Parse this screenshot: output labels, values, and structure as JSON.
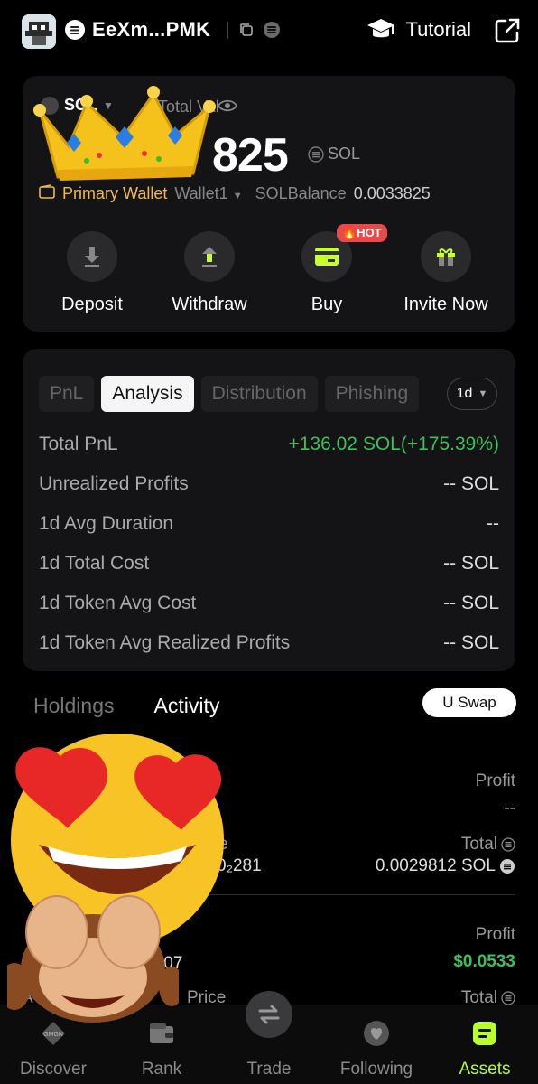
{
  "header": {
    "wallet_name": "EeXm...PMK",
    "separator": "|",
    "tutorial_label": "Tutorial"
  },
  "balance": {
    "currency_pill": "SOL",
    "total_label": "Total Val",
    "amount": "825",
    "unit": "SOL",
    "primary_wallet": "Primary Wallet",
    "wallet_select": "Wallet1",
    "sol_balance_label": "SOLBalance",
    "sol_balance_value": "0.0033825"
  },
  "actions": [
    {
      "label": "Deposit",
      "icon": "deposit-icon"
    },
    {
      "label": "Withdraw",
      "icon": "withdraw-icon"
    },
    {
      "label": "Buy",
      "icon": "card-icon",
      "badge": "🔥HOT"
    },
    {
      "label": "Invite Now",
      "icon": "gift-icon"
    }
  ],
  "analysis": {
    "tabs": [
      "PnL",
      "Analysis",
      "Distribution",
      "Phishing"
    ],
    "active_tab": "Analysis",
    "period": "1d",
    "rows": [
      {
        "label": "Total PnL",
        "value": "+136.02 SOL(+175.39%)"
      },
      {
        "label": "Unrealized Profits",
        "value": "-- SOL"
      },
      {
        "label": "1d Avg Duration",
        "value": "--"
      },
      {
        "label": "1d Total Cost",
        "value": "-- SOL"
      },
      {
        "label": "1d Token Avg Cost",
        "value": "-- SOL"
      },
      {
        "label": "1d Token Avg Realized Profits",
        "value": "-- SOL"
      }
    ]
  },
  "list": {
    "tabs": [
      "Holdings",
      "Activity"
    ],
    "active_tab": "Activity",
    "swap_button": "U Swap",
    "item1": {
      "profit_label": "Profit",
      "profit_value": "--",
      "price_frag": "e",
      "price_value_frag": "0₂281",
      "total_label": "Total",
      "total_value": "0.0029812 SOL"
    },
    "item2": {
      "profit_label": "Profit",
      "profit_value": "$0.0533",
      "price_value_frag": ".07",
      "price_label": "Price",
      "amount_frag": "A",
      "total_label": "Total"
    }
  },
  "nav": [
    {
      "label": "Discover",
      "icon": "gmgn-icon"
    },
    {
      "label": "Rank",
      "icon": "wallet-icon"
    },
    {
      "label": "Trade",
      "icon": "swap-icon"
    },
    {
      "label": "Following",
      "icon": "heart-icon"
    },
    {
      "label": "Assets",
      "icon": "assets-icon"
    }
  ],
  "colors": {
    "accent": "#b8ff2f",
    "gain": "#3fbf5a",
    "gold": "#f0b94a",
    "hot": "#e84a4a"
  }
}
